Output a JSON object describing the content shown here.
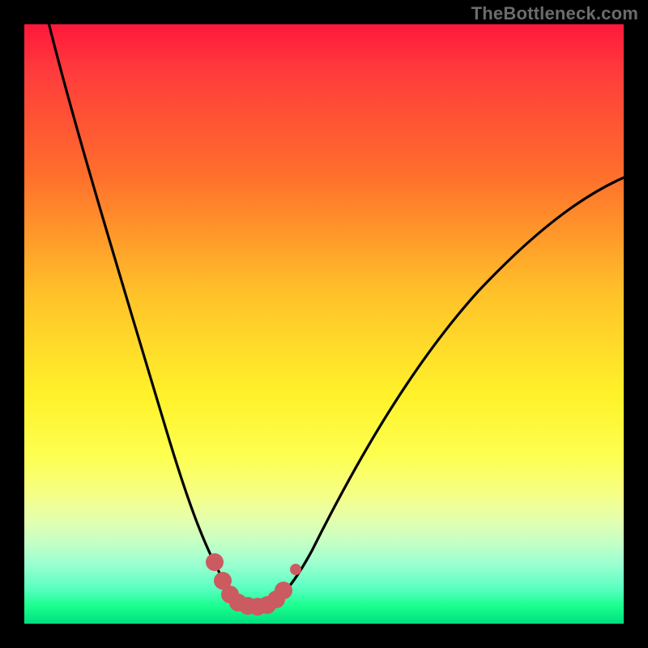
{
  "watermark_text": "TheBottleneck.com",
  "colors": {
    "background": "#000000",
    "marker": "#cb5b60",
    "curve": "#000000",
    "gradient_stops": [
      {
        "pct": 0,
        "hex": "#ff183c"
      },
      {
        "pct": 8,
        "hex": "#ff3c3c"
      },
      {
        "pct": 25,
        "hex": "#ff6e2c"
      },
      {
        "pct": 45,
        "hex": "#ffc229"
      },
      {
        "pct": 62,
        "hex": "#fff22a"
      },
      {
        "pct": 72,
        "hex": "#fdff50"
      },
      {
        "pct": 78,
        "hex": "#f6ff82"
      },
      {
        "pct": 82,
        "hex": "#e8ffa8"
      },
      {
        "pct": 86,
        "hex": "#c9ffc3"
      },
      {
        "pct": 90,
        "hex": "#9cffd1"
      },
      {
        "pct": 94,
        "hex": "#5bffc2"
      },
      {
        "pct": 97,
        "hex": "#1bff90"
      },
      {
        "pct": 100,
        "hex": "#00de7e"
      }
    ]
  },
  "chart_data": {
    "type": "line",
    "title": "",
    "xlabel": "",
    "ylabel": "",
    "x_range": [
      0,
      100
    ],
    "y_range": [
      0,
      100
    ],
    "description": "Bottleneck curve: high mismatch (red/upper) on both ends, dipping to near-zero (green/lower) around x≈34–40. Left branch drops steeply from ~100% at x=0; right branch rises gradually toward ~70% at x=100.",
    "series": [
      {
        "name": "bottleneck-curve",
        "x": [
          0,
          5,
          10,
          15,
          20,
          25,
          30,
          34,
          36,
          38,
          40,
          42,
          45,
          50,
          55,
          60,
          65,
          70,
          75,
          80,
          85,
          90,
          95,
          100
        ],
        "values": [
          100,
          92,
          80,
          65,
          48,
          30,
          14,
          3,
          1,
          1,
          1,
          2,
          5,
          12,
          20,
          28,
          35,
          41,
          47,
          52,
          56,
          60,
          63,
          66
        ]
      }
    ],
    "markers": {
      "name": "optimal-range-markers",
      "value_is": "y",
      "points": [
        {
          "x": 31.5,
          "y": 10
        },
        {
          "x": 32.8,
          "y": 6
        },
        {
          "x": 34.0,
          "y": 3
        },
        {
          "x": 35.5,
          "y": 1.5
        },
        {
          "x": 37.0,
          "y": 1
        },
        {
          "x": 38.5,
          "y": 1
        },
        {
          "x": 40.0,
          "y": 1.5
        },
        {
          "x": 41.5,
          "y": 2.5
        },
        {
          "x": 43.0,
          "y": 4
        },
        {
          "x": 45.0,
          "y": 8
        }
      ]
    }
  }
}
